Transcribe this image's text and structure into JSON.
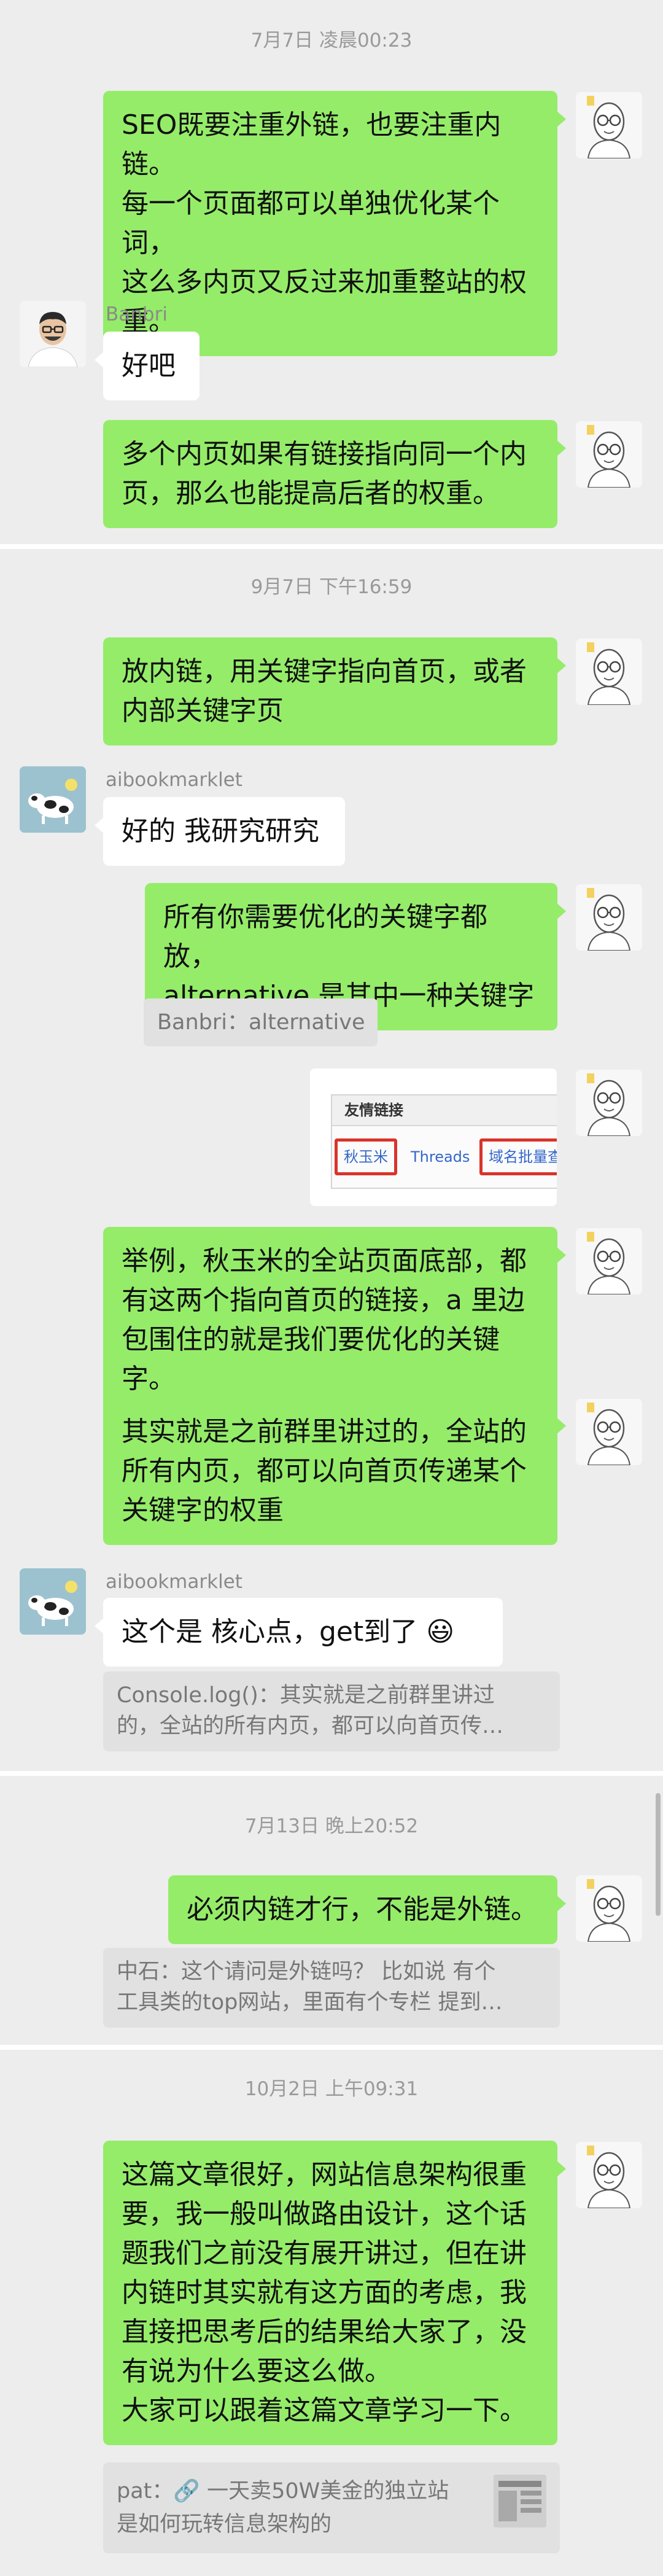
{
  "sections": [
    {
      "timestamp": "7月7日 凌晨00:23"
    },
    {
      "timestamp": "9月7日 下午16:59"
    },
    {
      "timestamp": "7月13日 晚上20:52"
    },
    {
      "timestamp": "10月2日 上午09:31"
    }
  ],
  "messages": {
    "m1": "SEO既要注重外链，也要注重内链。\n每一个页面都可以单独优化某个词，\n这么多内页又反过来加重整站的权\n重。",
    "banbri_name": "Banbri",
    "m2": "好吧",
    "m3": "多个内页如果有链接指向同一个内\n页，那么也能提高后者的权重。",
    "m4": "放内链，用关键字指向首页，或者\n内部关键字页",
    "aibook_name": "aibookmarklet",
    "m5": "好的 我研究研究",
    "m6": "所有你需要优化的关键字都放，\nalternative 是其中一种关键字",
    "q1": "Banbri：alternative",
    "img_header": "友情链接",
    "img_link1": "秋玉米",
    "img_link2": "Threads",
    "img_link3": "域名批量查",
    "m7": "举例，秋玉米的全站页面底部，都\n有这两个指向首页的链接，a 里边\n包围住的就是我们要优化的关键字。",
    "m8": "其实就是之前群里讲过的，全站的\n所有内页，都可以向首页传递某个\n关键字的权重",
    "aibook_name2": "aibookmarklet",
    "m9": "这个是 核心点，get到了 😃",
    "q2": "Console.log()：其实就是之前群里讲过\n的，全站的所有内页，都可以向首页传…",
    "m10": "必须内链才行，不能是外链。",
    "q3": "中石：这个请问是外链吗？ 比如说 有个\n工具类的top网站，里面有个专栏 提到…",
    "m11": "这篇文章很好，网站信息架构很重\n要，我一般叫做路由设计，这个话\n题我们之前没有展开讲过，但在讲\n内链时其实就有这方面的考虑，我\n直接把思考后的结果给大家了，没\n有说为什么要这么做。\n大家可以跟着这篇文章学习一下。",
    "q4": "pat：🔗 一天卖50W美金的独立站\n是如何玩转信息架构的"
  },
  "colors": {
    "background": "#ededed",
    "my_bubble": "#95ec69",
    "other_bubble": "#ffffff",
    "quote_bg": "#e1e1e1",
    "highlight_box": "#d9342b"
  }
}
